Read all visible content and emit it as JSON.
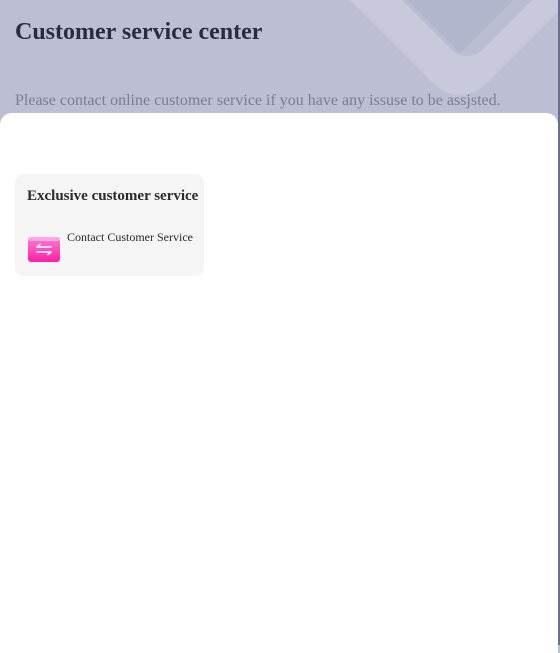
{
  "header": {
    "title": "Customer service center",
    "subtitle": "Please contact online customer service if you have any issuse to be assjsted."
  },
  "card": {
    "title": "Exclusive customer service",
    "items": [
      {
        "label": "Contact Customer Service",
        "icon": "swap-arrows-icon"
      }
    ]
  },
  "colors": {
    "header_bg": "#bcbfd3",
    "title": "#2b2b45",
    "subtitle": "#7a7c95",
    "card_bg": "#f4f5f4",
    "icon_pink": "#ff3fb4"
  }
}
